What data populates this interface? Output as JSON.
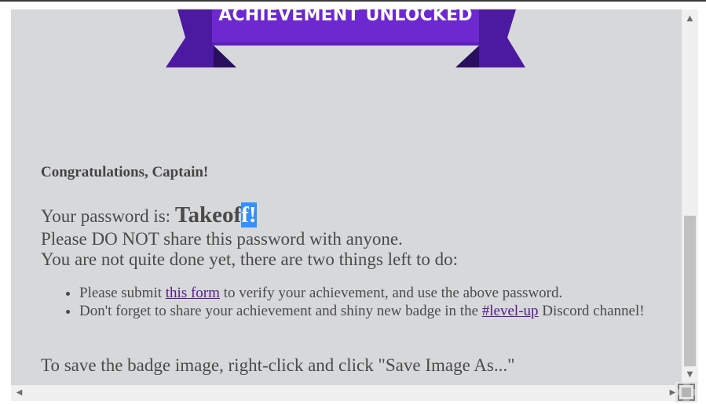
{
  "badge": {
    "banner_text": "ACHIEVEMENT UNLOCKED",
    "colors": {
      "ribbon_main": "#6d28d0",
      "ribbon_dark": "#4b1aa0",
      "ribbon_shadow": "#2a0f5e"
    }
  },
  "content": {
    "greeting": "Congratulations, Captain!",
    "password_label": "Your password is:",
    "password_plain": "Takeof",
    "password_selected": "f!",
    "warning": "Please DO NOT share this password with anyone.",
    "remaining": "You are not quite done yet, there are two things left to do:",
    "todo": [
      {
        "before": "Please submit ",
        "link": "this form",
        "after": " to verify your achievement, and use the above password."
      },
      {
        "before": "Don't forget to share your achievement and shiny new badge in the ",
        "link": "#level-up",
        "after": " Discord channel!"
      }
    ],
    "save_hint": "To save the badge image, right-click and click \"Save Image As...\""
  },
  "scrollbars": {
    "vertical_position": 0.85,
    "up_icon": "arrow-up-icon",
    "down_icon": "arrow-down-icon",
    "left_icon": "arrow-left-icon",
    "right_icon": "arrow-right-icon",
    "corner_icon": "fullscreen-icon"
  }
}
